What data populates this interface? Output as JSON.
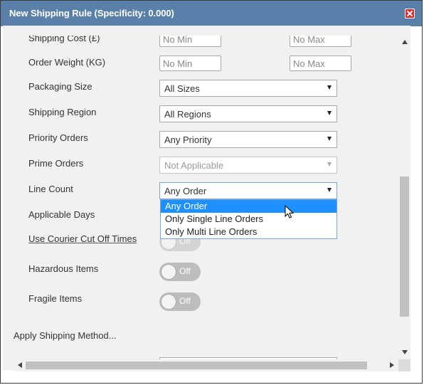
{
  "dialog": {
    "title": "New Shipping Rule (Specificity: 0.000)",
    "close_icon": "close-icon"
  },
  "form": {
    "shipping_cost": {
      "label": "Shipping Cost (£)",
      "min_placeholder": "No Min",
      "max_placeholder": "No Max"
    },
    "order_weight": {
      "label": "Order Weight (KG)",
      "min_placeholder": "No Min",
      "max_placeholder": "No Max"
    },
    "packaging_size": {
      "label": "Packaging Size",
      "value": "All Sizes"
    },
    "shipping_region": {
      "label": "Shipping Region",
      "value": "All Regions"
    },
    "priority_orders": {
      "label": "Priority Orders",
      "value": "Any Priority"
    },
    "prime_orders": {
      "label": "Prime Orders",
      "value": "Not Applicable"
    },
    "line_count": {
      "label": "Line Count",
      "value": "Any Order",
      "options": [
        "Any Order",
        "Only Single Line Orders",
        "Only Multi Line Orders"
      ]
    },
    "applicable_days": {
      "label": "Applicable Days"
    },
    "courier_cut_off": {
      "label": "Use Courier Cut Off Times",
      "state": "Off"
    },
    "hazardous_items": {
      "label": "Hazardous Items",
      "state": "Off"
    },
    "fragile_items": {
      "label": "Fragile Items",
      "state": "Off"
    },
    "apply_shipping_method": {
      "label": "Apply Shipping Method..."
    }
  },
  "colors": {
    "titlebar": "#5a7fa8",
    "close_button": "#e02a2a",
    "selected_option": "#1e90ff",
    "toggle_off": "#bdbdbd"
  }
}
